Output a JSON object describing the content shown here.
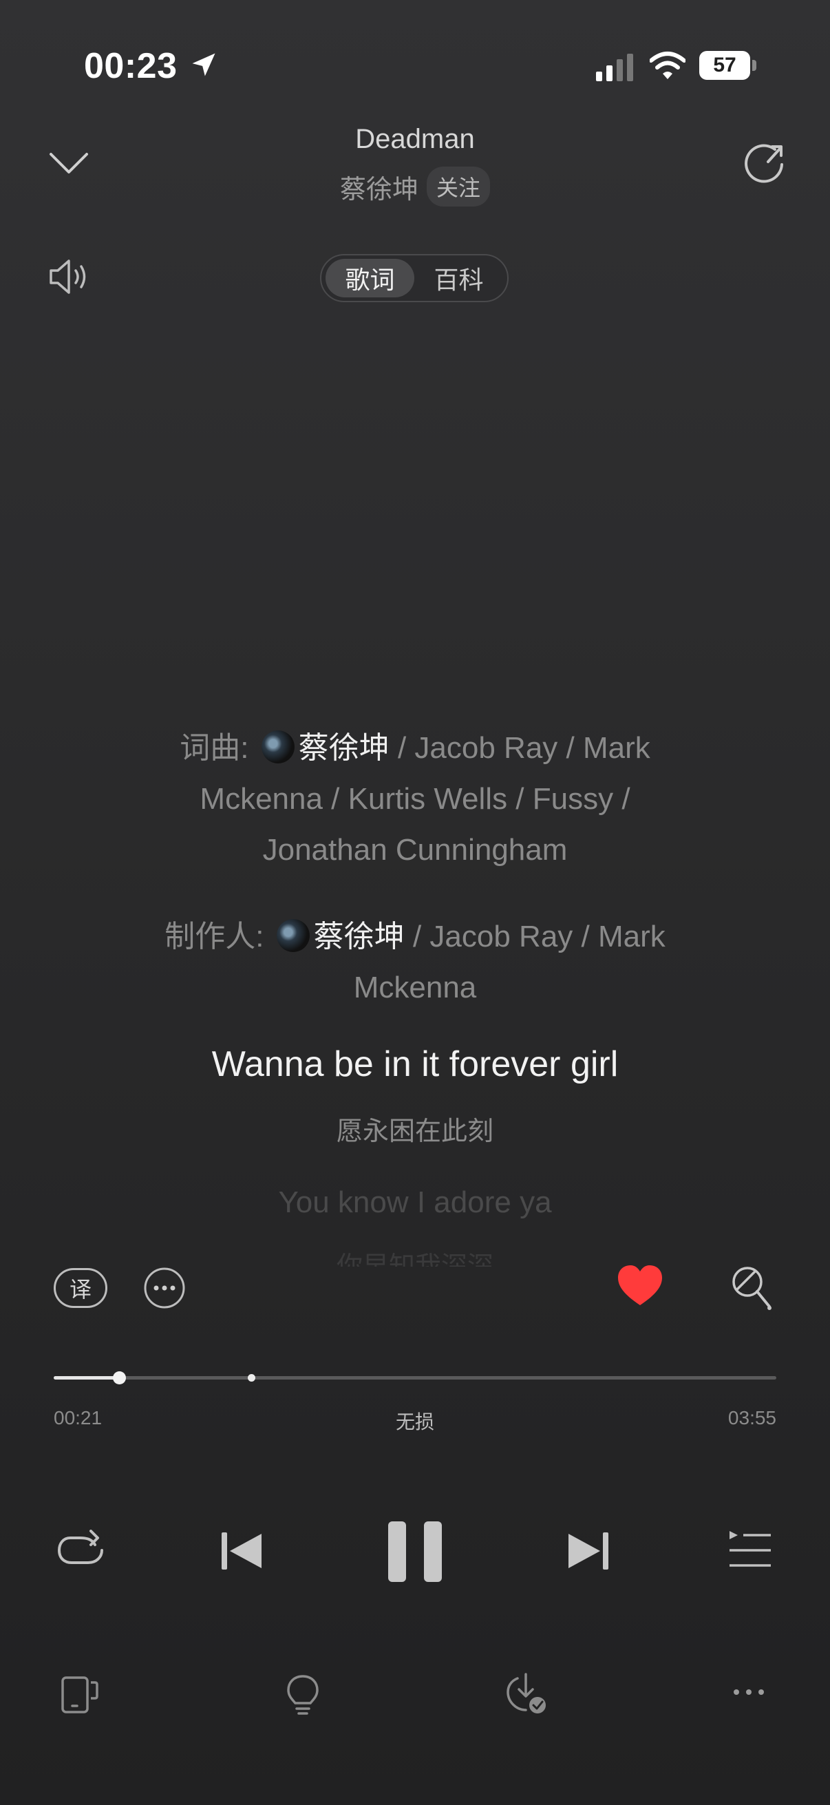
{
  "status_bar": {
    "time": "00:23",
    "battery_level": "57",
    "icons": [
      "location-arrow-icon",
      "cellular-signal-icon",
      "wifi-icon",
      "battery-icon"
    ]
  },
  "header": {
    "title": "Deadman",
    "artist": "蔡徐坤",
    "follow_label": "关注",
    "icons": [
      "chevron-down-icon",
      "share-icon",
      "volume-icon"
    ]
  },
  "tabs": [
    {
      "label": "歌词",
      "active": true
    },
    {
      "label": "百科",
      "active": false
    }
  ],
  "lyrics": {
    "credits": {
      "composer_label": "词曲:",
      "composer_lines": [
        "/ Jacob Ray / Mark",
        "Mckenna / Kurtis Wells / Fussy /",
        "Jonathan Cunningham"
      ],
      "producer_label": "制作人:",
      "producer_lines": [
        "/ Jacob Ray / Mark",
        "Mckenna"
      ],
      "highlighted_name": "蔡徐坤"
    },
    "current_line": "Wanna be in it forever girl",
    "current_translation": "愿永困在此刻",
    "next_line": "You know I adore ya",
    "next_translation": "你早知我深深"
  },
  "actions": {
    "translate_label": "译",
    "liked": true,
    "icons": [
      "translate-icon",
      "more-circle-icon",
      "heart-icon",
      "karaoke-mic-icon"
    ]
  },
  "progress": {
    "elapsed": "00:21",
    "total": "03:55",
    "quality": "无损",
    "fraction": 0.09,
    "marker_fraction": 0.273
  },
  "controls": {
    "state": "playing",
    "icons": [
      "repeat-icon",
      "previous-icon",
      "pause-icon",
      "next-icon",
      "playlist-icon"
    ]
  },
  "bottom_bar": {
    "icons": [
      "device-icon",
      "lightbulb-icon",
      "download-check-icon",
      "more-dots-icon"
    ]
  },
  "colors": {
    "heart": "#ff3b3b",
    "text_primary": "#f2f2f2",
    "text_secondary": "#8a8a8a"
  }
}
